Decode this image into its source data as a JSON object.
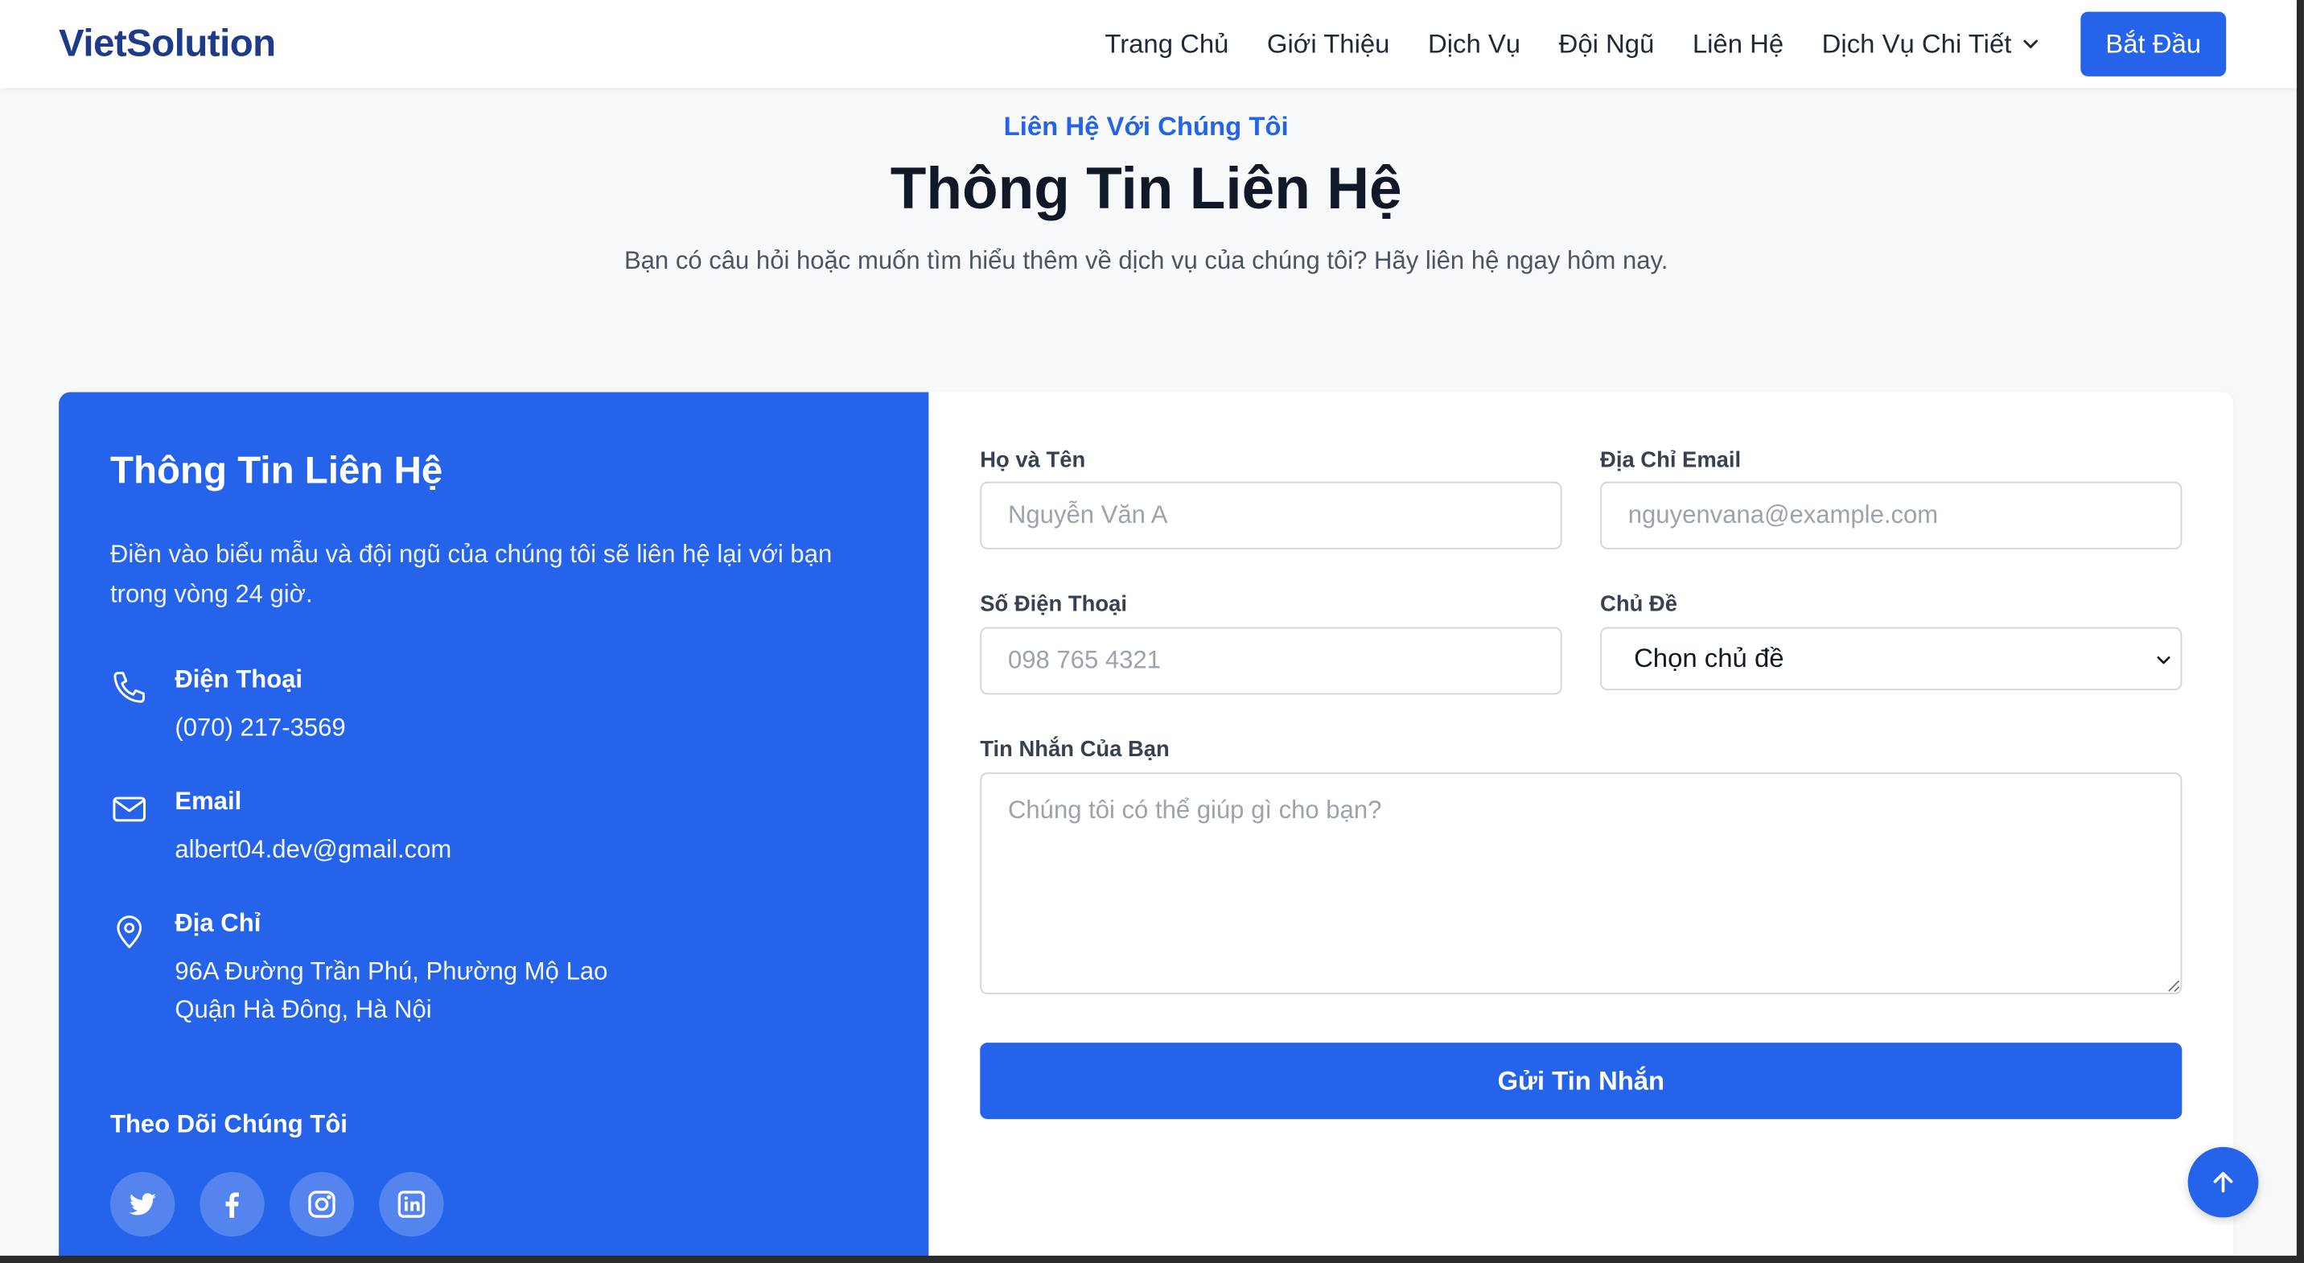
{
  "header": {
    "logo": "VietSolution",
    "nav": [
      "Trang Chủ",
      "Giới Thiệu",
      "Dịch Vụ",
      "Đội Ngũ",
      "Liên Hệ",
      "Dịch Vụ Chi Tiết"
    ],
    "cta": "Bắt Đầu"
  },
  "section": {
    "eyebrow": "Liên Hệ Với Chúng Tôi",
    "title": "Thông Tin Liên Hệ",
    "subtitle": "Bạn có câu hỏi hoặc muốn tìm hiểu thêm về dịch vụ của chúng tôi? Hãy liên hệ ngay hôm nay."
  },
  "info": {
    "title": "Thông Tin Liên Hệ",
    "description": "Điền vào biểu mẫu và đội ngũ của chúng tôi sẽ liên hệ lại với bạn trong vòng 24 giờ.",
    "phone_label": "Điện Thoại",
    "phone": "(070) 217-3569",
    "email_label": "Email",
    "email": "albert04.dev@gmail.com",
    "address_label": "Địa Chỉ",
    "address_line1": "96A Đường Trần Phú, Phường Mộ Lao",
    "address_line2": "Quận Hà Đông, Hà Nội",
    "follow": "Theo Dõi Chúng Tôi",
    "socials": [
      "twitter-icon",
      "facebook-icon",
      "instagram-icon",
      "linkedin-icon"
    ]
  },
  "form": {
    "name_label": "Họ và Tên",
    "name_placeholder": "Nguyễn Văn A",
    "email_label": "Địa Chỉ Email",
    "email_placeholder": "nguyenvana@example.com",
    "phone_label": "Số Điện Thoại",
    "phone_placeholder": "098 765 4321",
    "topic_label": "Chủ Đề",
    "topic_selected": "Chọn chủ đề",
    "message_label": "Tin Nhắn Của Bạn",
    "message_placeholder": "Chúng tôi có thể giúp gì cho bạn?",
    "submit": "Gửi Tin Nhắn"
  },
  "colors": {
    "accent": "#2563eb",
    "logo": "#1e3a8a"
  }
}
